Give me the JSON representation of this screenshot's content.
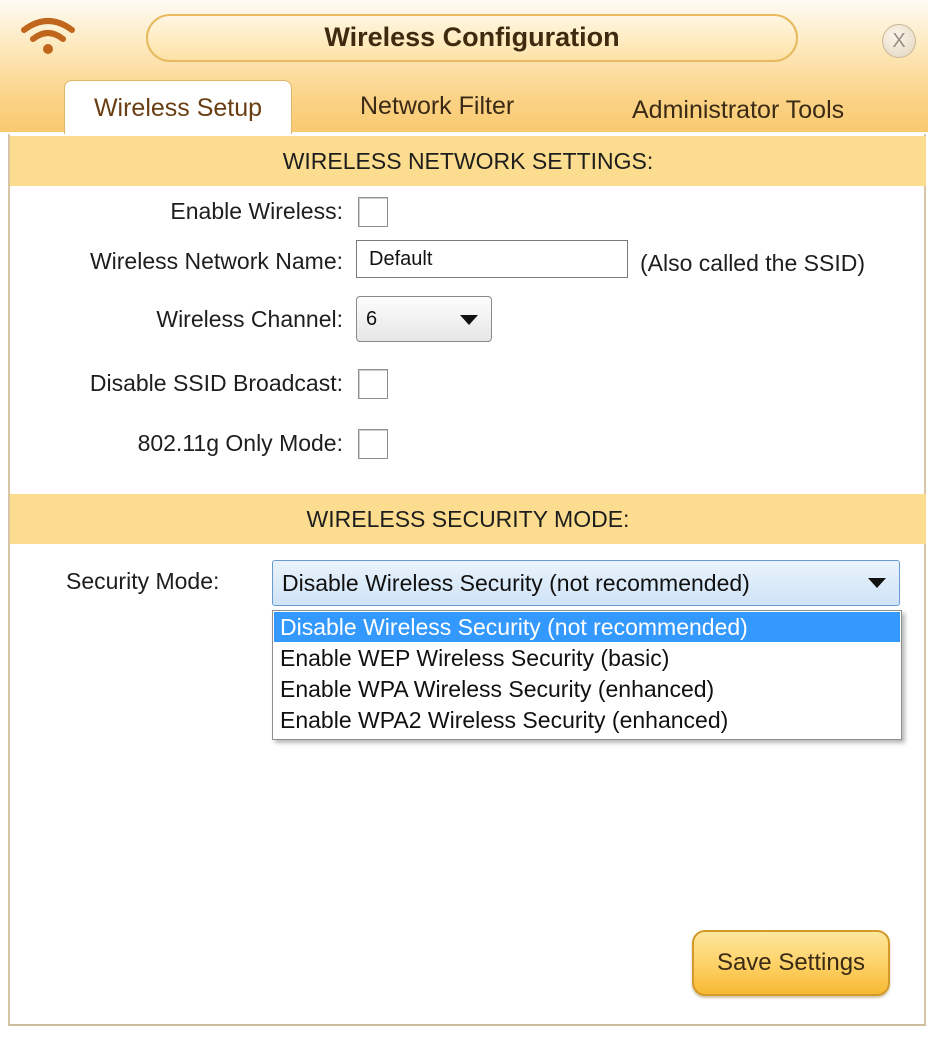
{
  "window": {
    "title": "Wireless Configuration",
    "close_label": "X",
    "wifi_icon": "wifi-icon",
    "accent_color": "#fcdc8e"
  },
  "tabs": [
    {
      "label": "Wireless Setup",
      "active": true
    },
    {
      "label": "Network Filter",
      "active": false
    },
    {
      "label": "Administrator Tools",
      "active": false
    }
  ],
  "network_settings": {
    "header": "WIRELESS NETWORK SETTINGS:",
    "enable_wireless": {
      "label": "Enable Wireless:",
      "checked": false
    },
    "network_name": {
      "label": "Wireless Network Name:",
      "value": "Default",
      "note": "(Also called the SSID)"
    },
    "channel": {
      "label": "Wireless Channel:",
      "value": "6"
    },
    "disable_ssid_broadcast": {
      "label": "Disable SSID Broadcast:",
      "checked": false
    },
    "g_only_mode": {
      "label": "802.11g Only Mode:",
      "checked": false
    }
  },
  "security": {
    "header": "WIRELESS SECURITY MODE:",
    "mode_label": "Security Mode:",
    "selected": "Disable Wireless Security (not recommended)",
    "options": [
      "Disable Wireless Security (not recommended)",
      "Enable WEP Wireless Security (basic)",
      "Enable WPA Wireless Security (enhanced)",
      "Enable WPA2 Wireless Security (enhanced)"
    ]
  },
  "actions": {
    "save_label": "Save Settings"
  }
}
